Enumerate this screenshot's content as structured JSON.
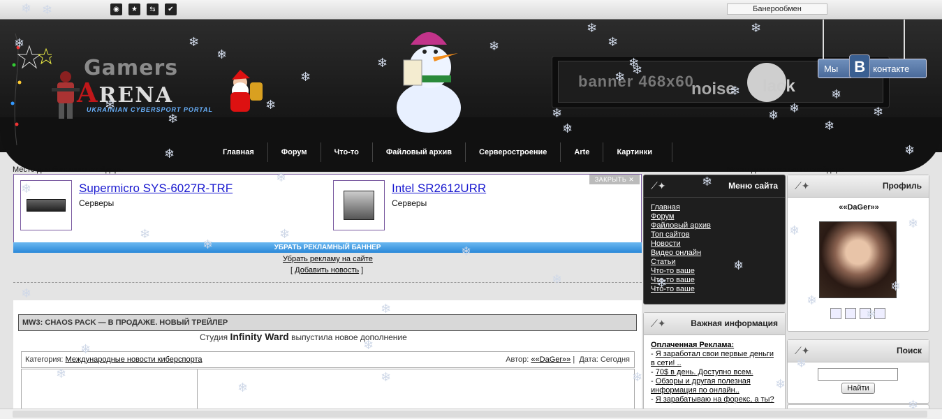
{
  "top_icons": [
    "rss-icon",
    "star-icon",
    "share-icon",
    "check-icon"
  ],
  "top_icon_glyphs": [
    "◉",
    "★",
    "⇆",
    "✔"
  ],
  "banner_exchange": "Банерообмен",
  "logo": {
    "line1": "Gamers",
    "line2_accent": "A",
    "line2_rest": "RENA",
    "subtitle": "UKRAINIAN CYBERSPORT PORTAL"
  },
  "header_banner": {
    "text": "banner 468x60",
    "brand1": "noise",
    "brand2": "lack"
  },
  "vk": {
    "we": "Мы",
    "letter": "B",
    "label": "контакте"
  },
  "nav": [
    "Главная",
    "Форум",
    "Что-то",
    "Файловый архив",
    "Серверостроение",
    "Arte",
    "Картинки"
  ],
  "slider_labels": {
    "big": "Место для большого слайдера",
    "small": "Место для маленького слайдера"
  },
  "ads": [
    {
      "title": "Supermicro SYS-6027R-TRF",
      "category": "Серверы"
    },
    {
      "title": "Intel SR2612URR",
      "category": "Серверы"
    }
  ],
  "close_label": "ЗАКРЫТЬ ✕",
  "remove_banner": "УБРАТЬ РЕКЛАМНЫЙ БАННЕР",
  "remove_site": "Убрать рекламу на сайте",
  "add_news": {
    "open": "[ ",
    "link": "Добавить новость",
    "close": " ]"
  },
  "news": {
    "title": "MW3: CHAOS PACK — В ПРОДАЖЕ. НОВЫЙ ТРЕЙЛЕР",
    "category_label": "Категория:",
    "category": "Международные новости киберспорта",
    "author_label": "Автор:",
    "author": "««DaGer»»",
    "sep": "|",
    "date_label": "Дата:",
    "date": "Сегодня",
    "text_start": "Студия",
    "studio": "Infinity Ward",
    "text_rest": "выпустила новое дополнение"
  },
  "menu_site": {
    "title": "Меню сайта",
    "items": [
      "Главная",
      "Форум",
      "Файловый архив",
      "Топ сайтов",
      "Новости",
      "Видео онлайн",
      "Статьи",
      "Что-то ваше",
      "Что-то ваше",
      "Что-то ваше"
    ]
  },
  "important": {
    "title": "Важная информация",
    "heading": "Оплаченная Реклама:",
    "items": [
      "Я заработал свои первые деньги в сети! ..",
      "70$ в день. Доступно всем.",
      "Обзоры и другая полезная информация по онлайн..",
      "Я зарабатываю на форекс, а ты?"
    ]
  },
  "profile": {
    "title": "Профиль",
    "name": "««DaGer»»"
  },
  "search": {
    "title": "Поиск",
    "button": "Найти",
    "value": ""
  },
  "colors": {
    "accent": "#c0171a",
    "link": "#1b1bd0",
    "remove_bar": "#2a88d8",
    "vk": "#4a6a9a"
  }
}
